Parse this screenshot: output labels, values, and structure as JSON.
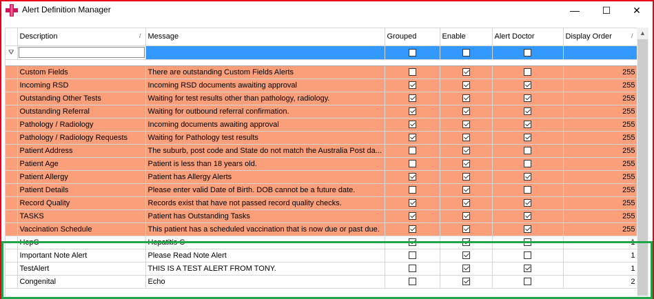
{
  "window": {
    "title": "Alert Definition Manager",
    "minimize": "—",
    "maximize": "☐",
    "close": "✕"
  },
  "colors": {
    "highlight_border": "#e8001b",
    "green_box": "#1fa64a",
    "row_orange": "#fa9f7a",
    "selection": "#3399ff"
  },
  "grid": {
    "columns": [
      "Description",
      "Message",
      "Grouped",
      "Enable",
      "Alert Doctor",
      "Display Order"
    ],
    "filter_icon": "funnel-icon",
    "rows": [
      {
        "description": "Custom Fields",
        "message": "There are outstanding Custom Fields Alerts",
        "grouped": false,
        "enable": true,
        "alert_doctor": false,
        "order": "255",
        "style": "orange"
      },
      {
        "description": "Incoming RSD",
        "message": "Incoming RSD documents awaiting approval",
        "grouped": true,
        "enable": true,
        "alert_doctor": true,
        "order": "255",
        "style": "orange"
      },
      {
        "description": "Outstanding Other Tests",
        "message": "Waiting for test results other than pathology, radiology.",
        "grouped": true,
        "enable": true,
        "alert_doctor": true,
        "order": "255",
        "style": "orange"
      },
      {
        "description": "Outstanding Referral",
        "message": "Waiting for outbound referral confirmation.",
        "grouped": true,
        "enable": true,
        "alert_doctor": true,
        "order": "255",
        "style": "orange"
      },
      {
        "description": "Pathology / Radiology",
        "message": "Incoming documents awaiting approval",
        "grouped": true,
        "enable": true,
        "alert_doctor": true,
        "order": "255",
        "style": "orange"
      },
      {
        "description": "Pathology / Radiology  Requests",
        "message": "Waiting for Pathology test results",
        "grouped": true,
        "enable": true,
        "alert_doctor": true,
        "order": "255",
        "style": "orange"
      },
      {
        "description": "Patient Address",
        "message": "The suburb, post code and State do not match the Australia Post da...",
        "grouped": false,
        "enable": true,
        "alert_doctor": false,
        "order": "255",
        "style": "orange"
      },
      {
        "description": "Patient Age",
        "message": "Patient is less than 18 years old.",
        "grouped": false,
        "enable": true,
        "alert_doctor": false,
        "order": "255",
        "style": "orange"
      },
      {
        "description": "Patient Allergy",
        "message": "Patient has Allergy Alerts",
        "grouped": true,
        "enable": true,
        "alert_doctor": true,
        "order": "255",
        "style": "orange"
      },
      {
        "description": "Patient Details",
        "message": "Please enter valid Date of Birth.  DOB cannot be a future date.",
        "grouped": false,
        "enable": true,
        "alert_doctor": false,
        "order": "255",
        "style": "orange"
      },
      {
        "description": "Record Quality",
        "message": "Records exist that have not passed record quality checks.",
        "grouped": true,
        "enable": true,
        "alert_doctor": true,
        "order": "255",
        "style": "orange"
      },
      {
        "description": "TASKS",
        "message": "Patient has Outstanding Tasks",
        "grouped": true,
        "enable": true,
        "alert_doctor": true,
        "order": "255",
        "style": "orange"
      },
      {
        "description": "Vaccination Schedule",
        "message": "This patient has a scheduled vaccination that is now due or past due.",
        "grouped": true,
        "enable": true,
        "alert_doctor": true,
        "order": "255",
        "style": "orange"
      },
      {
        "description": "HepC",
        "message": "Hepatitis C",
        "grouped": true,
        "enable": true,
        "alert_doctor": false,
        "order": "1",
        "style": "white"
      },
      {
        "description": "Important Note Alert",
        "message": "Please Read Note Alert",
        "grouped": false,
        "enable": true,
        "alert_doctor": false,
        "order": "1",
        "style": "white"
      },
      {
        "description": "TestAlert",
        "message": "THIS IS A TEST ALERT FROM TONY.",
        "grouped": false,
        "enable": true,
        "alert_doctor": true,
        "order": "1",
        "style": "white"
      },
      {
        "description": "Congenital",
        "message": "Echo",
        "grouped": false,
        "enable": true,
        "alert_doctor": false,
        "order": "2",
        "style": "white"
      }
    ]
  }
}
